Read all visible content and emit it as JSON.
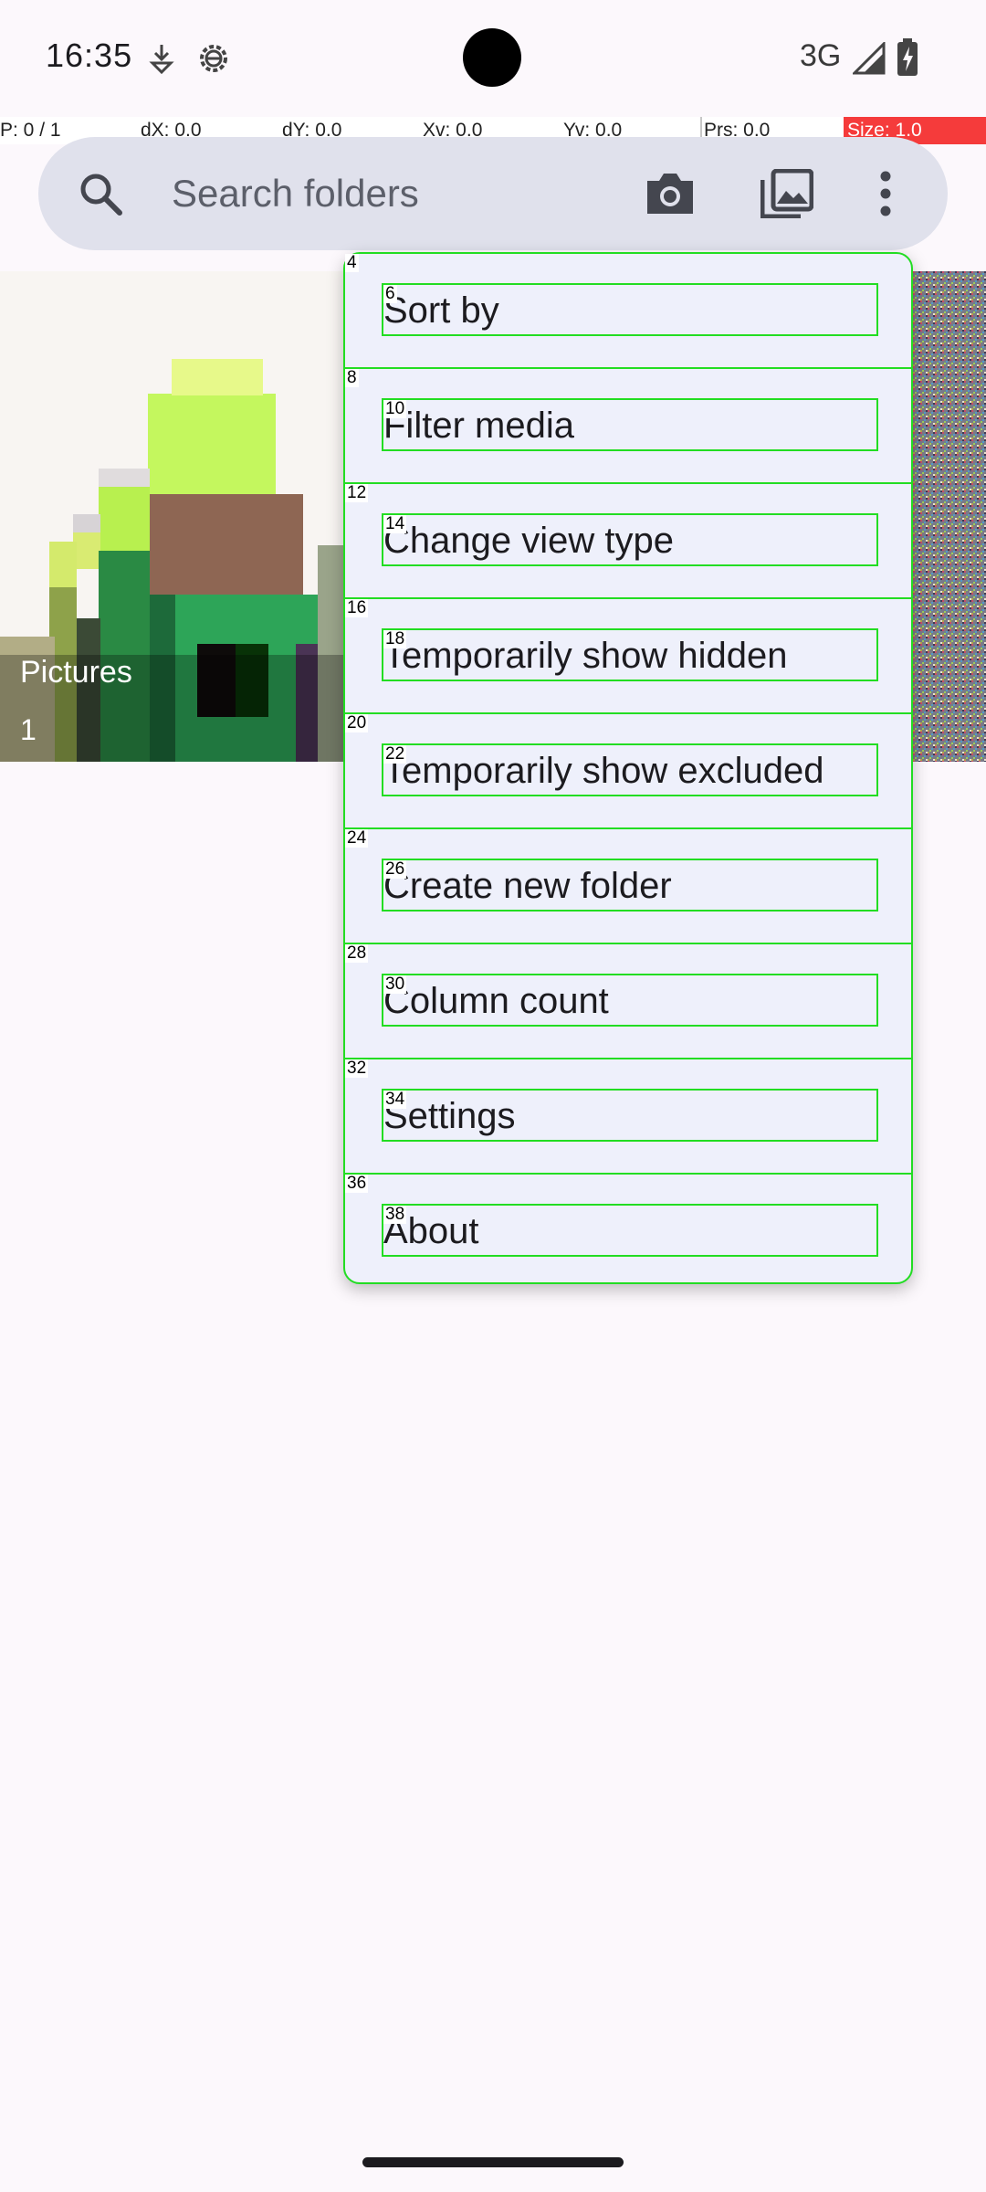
{
  "status_bar": {
    "time": "16:35",
    "network": "3G",
    "icons": [
      "download-icon",
      "settings-gear-icon",
      "signal-icon",
      "battery-icon"
    ]
  },
  "debug_bar": {
    "pointer": "P: 0 / 1",
    "dx": "dX: 0.0",
    "dy": "dY: 0.0",
    "xv": "Xv: 0.0",
    "yv": "Yv: 0.0",
    "prs": "Prs: 0.0",
    "size": "Size: 1.0"
  },
  "search": {
    "placeholder": "Search folders",
    "icons": [
      "search-icon",
      "camera-icon",
      "gallery-icon",
      "more-vert-icon"
    ]
  },
  "folders": [
    {
      "name": "Pictures",
      "count": "1"
    }
  ],
  "menu": {
    "items": [
      {
        "label": "Sort by",
        "outer_tag": "4",
        "inner_tag": "6"
      },
      {
        "label": "Filter media",
        "outer_tag": "8",
        "inner_tag": "10"
      },
      {
        "label": "Change view type",
        "outer_tag": "12",
        "inner_tag": "14"
      },
      {
        "label": "Temporarily show hidden",
        "outer_tag": "16",
        "inner_tag": "18"
      },
      {
        "label": "Temporarily show excluded",
        "outer_tag": "20",
        "inner_tag": "22"
      },
      {
        "label": "Create new folder",
        "outer_tag": "24",
        "inner_tag": "26"
      },
      {
        "label": "Column count",
        "outer_tag": "28",
        "inner_tag": "30"
      },
      {
        "label": "Settings",
        "outer_tag": "32",
        "inner_tag": "34"
      },
      {
        "label": "About",
        "outer_tag": "36",
        "inner_tag": "38"
      }
    ]
  },
  "colors": {
    "highlight_box": "#22dd22",
    "menu_background": "#eef0fb",
    "search_background": "#e0e1ec",
    "size_badge": "#f53b3b"
  }
}
